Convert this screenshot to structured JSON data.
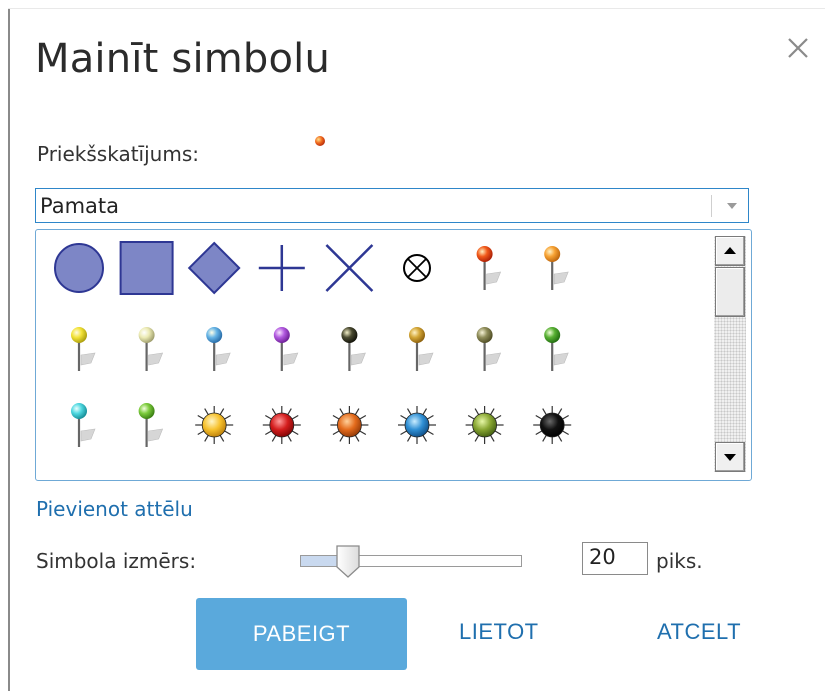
{
  "dialog": {
    "title": "Mainīt simbolu",
    "close_icon": "close-icon"
  },
  "preview": {
    "label": "Priekšskatījums:",
    "symbol": "red-pushpin-dot"
  },
  "category_select": {
    "value": "Pamata",
    "arrow_icon": "chevron-down-icon"
  },
  "symbols": [
    [
      "circle",
      "square",
      "diamond",
      "cross",
      "x",
      "circle-x",
      "pushpin-red",
      "pushpin-orange"
    ],
    [
      "pushpin-yellow",
      "pushpin-light-yellow",
      "pushpin-light-blue",
      "pushpin-purple",
      "pushpin-black",
      "pushpin-gold",
      "pushpin-olive",
      "pushpin-green"
    ],
    [
      "pushpin-cyan",
      "pushpin-lime",
      "sun-yellow",
      "sun-red",
      "sun-orange",
      "sun-blue",
      "sun-green",
      "sun-black"
    ]
  ],
  "colors": {
    "shape_fill": "#7d86c6",
    "shape_stroke": "#2e3794",
    "accent": "#5aa9dc",
    "link": "#1f6fae"
  },
  "add_image_link": "Pievienot attēlu",
  "size": {
    "label": "Simbola izmērs:",
    "value": "20",
    "unit": "piks.",
    "slider_fraction": 0.2
  },
  "buttons": {
    "finish": "PABEIGT",
    "apply": "LIETOT",
    "cancel": "ATCELT"
  }
}
